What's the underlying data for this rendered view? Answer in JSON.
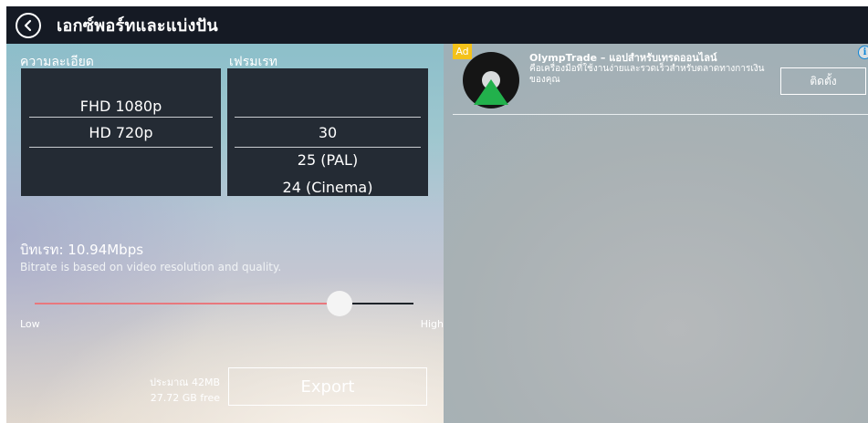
{
  "header": {
    "title": "เอกซ์พอร์ทและแบ่งปัน",
    "back_icon": "back-arrow-icon"
  },
  "settings": {
    "resolution": {
      "label": "ความละเอียด",
      "options": [
        "FHD 1080p",
        "HD 720p"
      ],
      "selected": "HD 720p"
    },
    "frame_rate": {
      "label": "เฟรมเรท",
      "options": [
        "30",
        "25 (PAL)",
        "24 (Cinema)"
      ],
      "selected": "30"
    }
  },
  "bitrate": {
    "value_label": "บิทเรท: 10.94Mbps",
    "note": "Bitrate is based on video resolution and quality.",
    "slider_level": 0.8,
    "low_label": "Low",
    "high_label": "High"
  },
  "export": {
    "estimate_size": "ประมาณ 42MB",
    "free_space": "27.72 GB free",
    "button_label": "Export"
  },
  "ad": {
    "badge": "Ad",
    "title": "OlympTrade – แอปสำหรับเทรดออนไลน์",
    "description": "คือเครื่องมือที่ใช้งานง่ายและรวดเร็วสำหรับตลาดทางการเงินของคุณ",
    "install_label": "ติดตั้ง",
    "info_icon": "i"
  },
  "colors": {
    "header_bg": "#151a24",
    "picker_bg": "#242b34",
    "slider_active": "#e8787d",
    "ad_badge": "#f4c21a",
    "logo_green": "#22b14c"
  }
}
